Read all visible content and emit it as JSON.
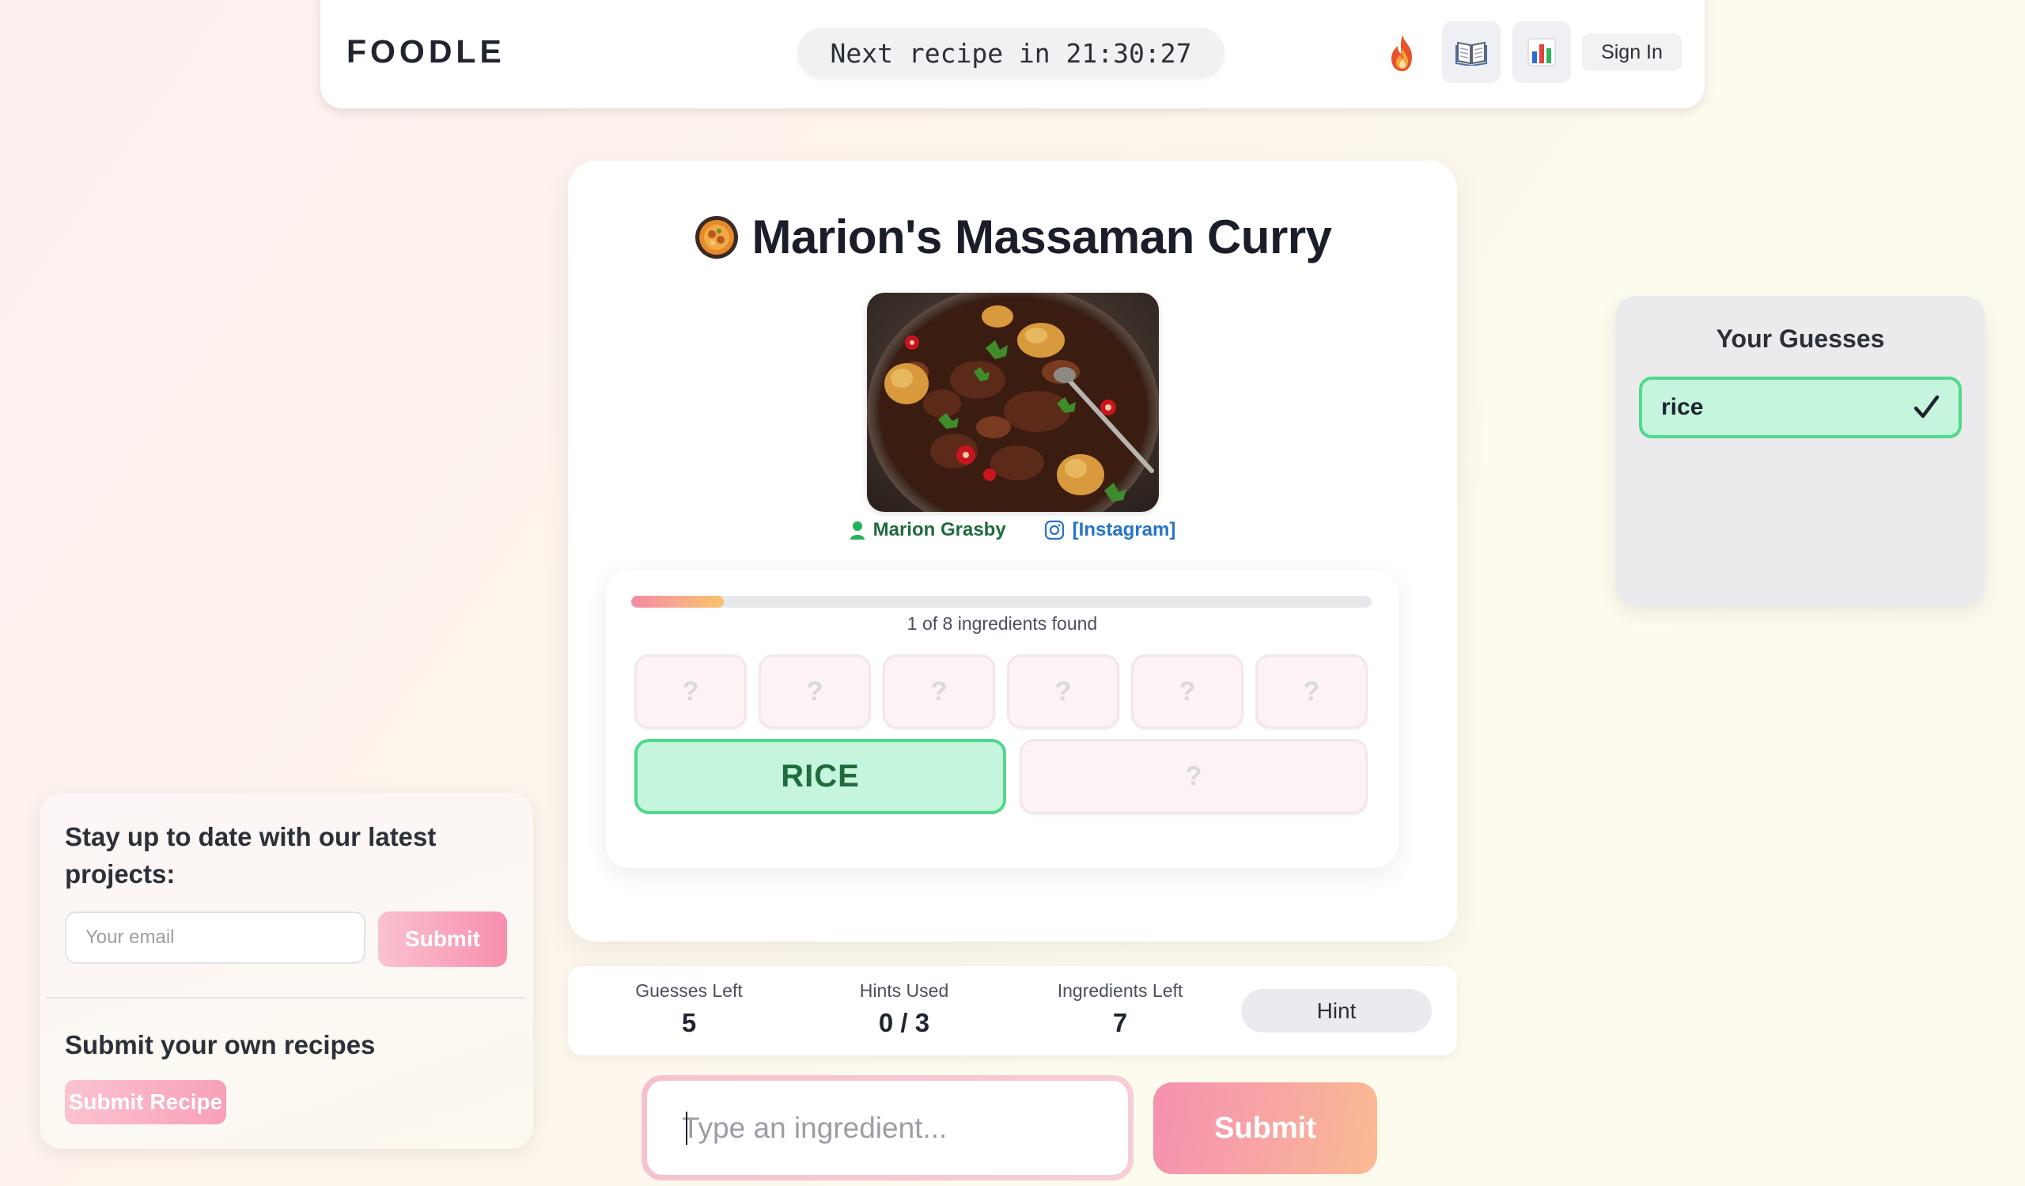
{
  "header": {
    "logo": "FOODLE",
    "timer": "Next recipe in 21:30:27",
    "streak_icon": "fire-icon",
    "book_icon": "book-icon",
    "stats_icon": "bar-chart-icon",
    "sign_in_label": "Sign In"
  },
  "recipe": {
    "emoji_icon": "curry-bowl-icon",
    "title": "Marion's Massaman Curry",
    "image_alt": "massaman curry dish",
    "author": "Marion Grasby",
    "link_label": "[Instagram]"
  },
  "progress": {
    "found": 1,
    "total": 8,
    "fraction": 0.125,
    "text": "1 of 8 ingredients found"
  },
  "ingredients": {
    "hidden_symbol": "?",
    "found_label": "RICE"
  },
  "stats": {
    "guesses_left_label": "Guesses Left",
    "guesses_left_value": "5",
    "hints_used_label": "Hints Used",
    "hints_used_value": "0 / 3",
    "ingredients_left_label": "Ingredients Left",
    "ingredients_left_value": "7",
    "hint_button": "Hint"
  },
  "input": {
    "placeholder": "Type an ingredient...",
    "submit_label": "Submit"
  },
  "guesses": {
    "title": "Your Guesses",
    "items": [
      {
        "text": "rice",
        "status": "correct"
      }
    ]
  },
  "newsletter": {
    "title": "Stay up to date with our latest projects:",
    "email_placeholder": "Your email",
    "submit_label": "Submit",
    "recipes_title": "Submit your own recipes",
    "submit_recipe_label": "Submit Recipe"
  },
  "colors": {
    "found_bg": "#c5f5dc",
    "found_border": "#4fd98b",
    "found_text": "#1f6b3d",
    "accent_pink": "#f690b0",
    "accent_peach": "#fbbb92",
    "link_blue": "#2474c9"
  }
}
